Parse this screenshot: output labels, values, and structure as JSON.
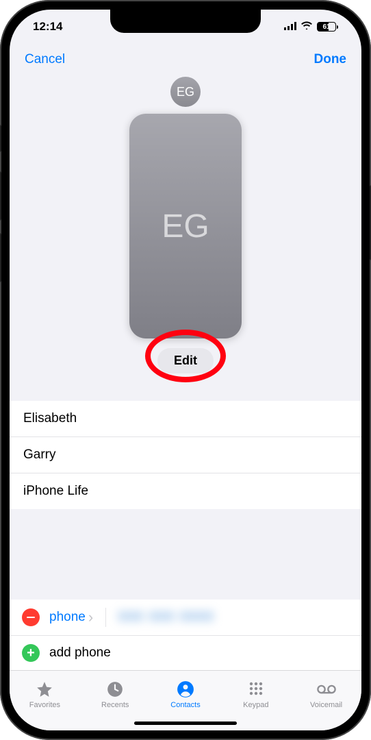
{
  "status": {
    "time": "12:14",
    "battery_pct": "61"
  },
  "nav": {
    "cancel": "Cancel",
    "done": "Done"
  },
  "contact": {
    "initials_small": "EG",
    "initials_large": "EG",
    "edit_label": "Edit"
  },
  "fields": {
    "first_name": "Elisabeth",
    "last_name": "Garry",
    "company": "iPhone Life"
  },
  "phone": {
    "label": "phone",
    "number": "888 888 8888",
    "add_label": "add phone"
  },
  "tabs": {
    "favorites": "Favorites",
    "recents": "Recents",
    "contacts": "Contacts",
    "keypad": "Keypad",
    "voicemail": "Voicemail"
  }
}
